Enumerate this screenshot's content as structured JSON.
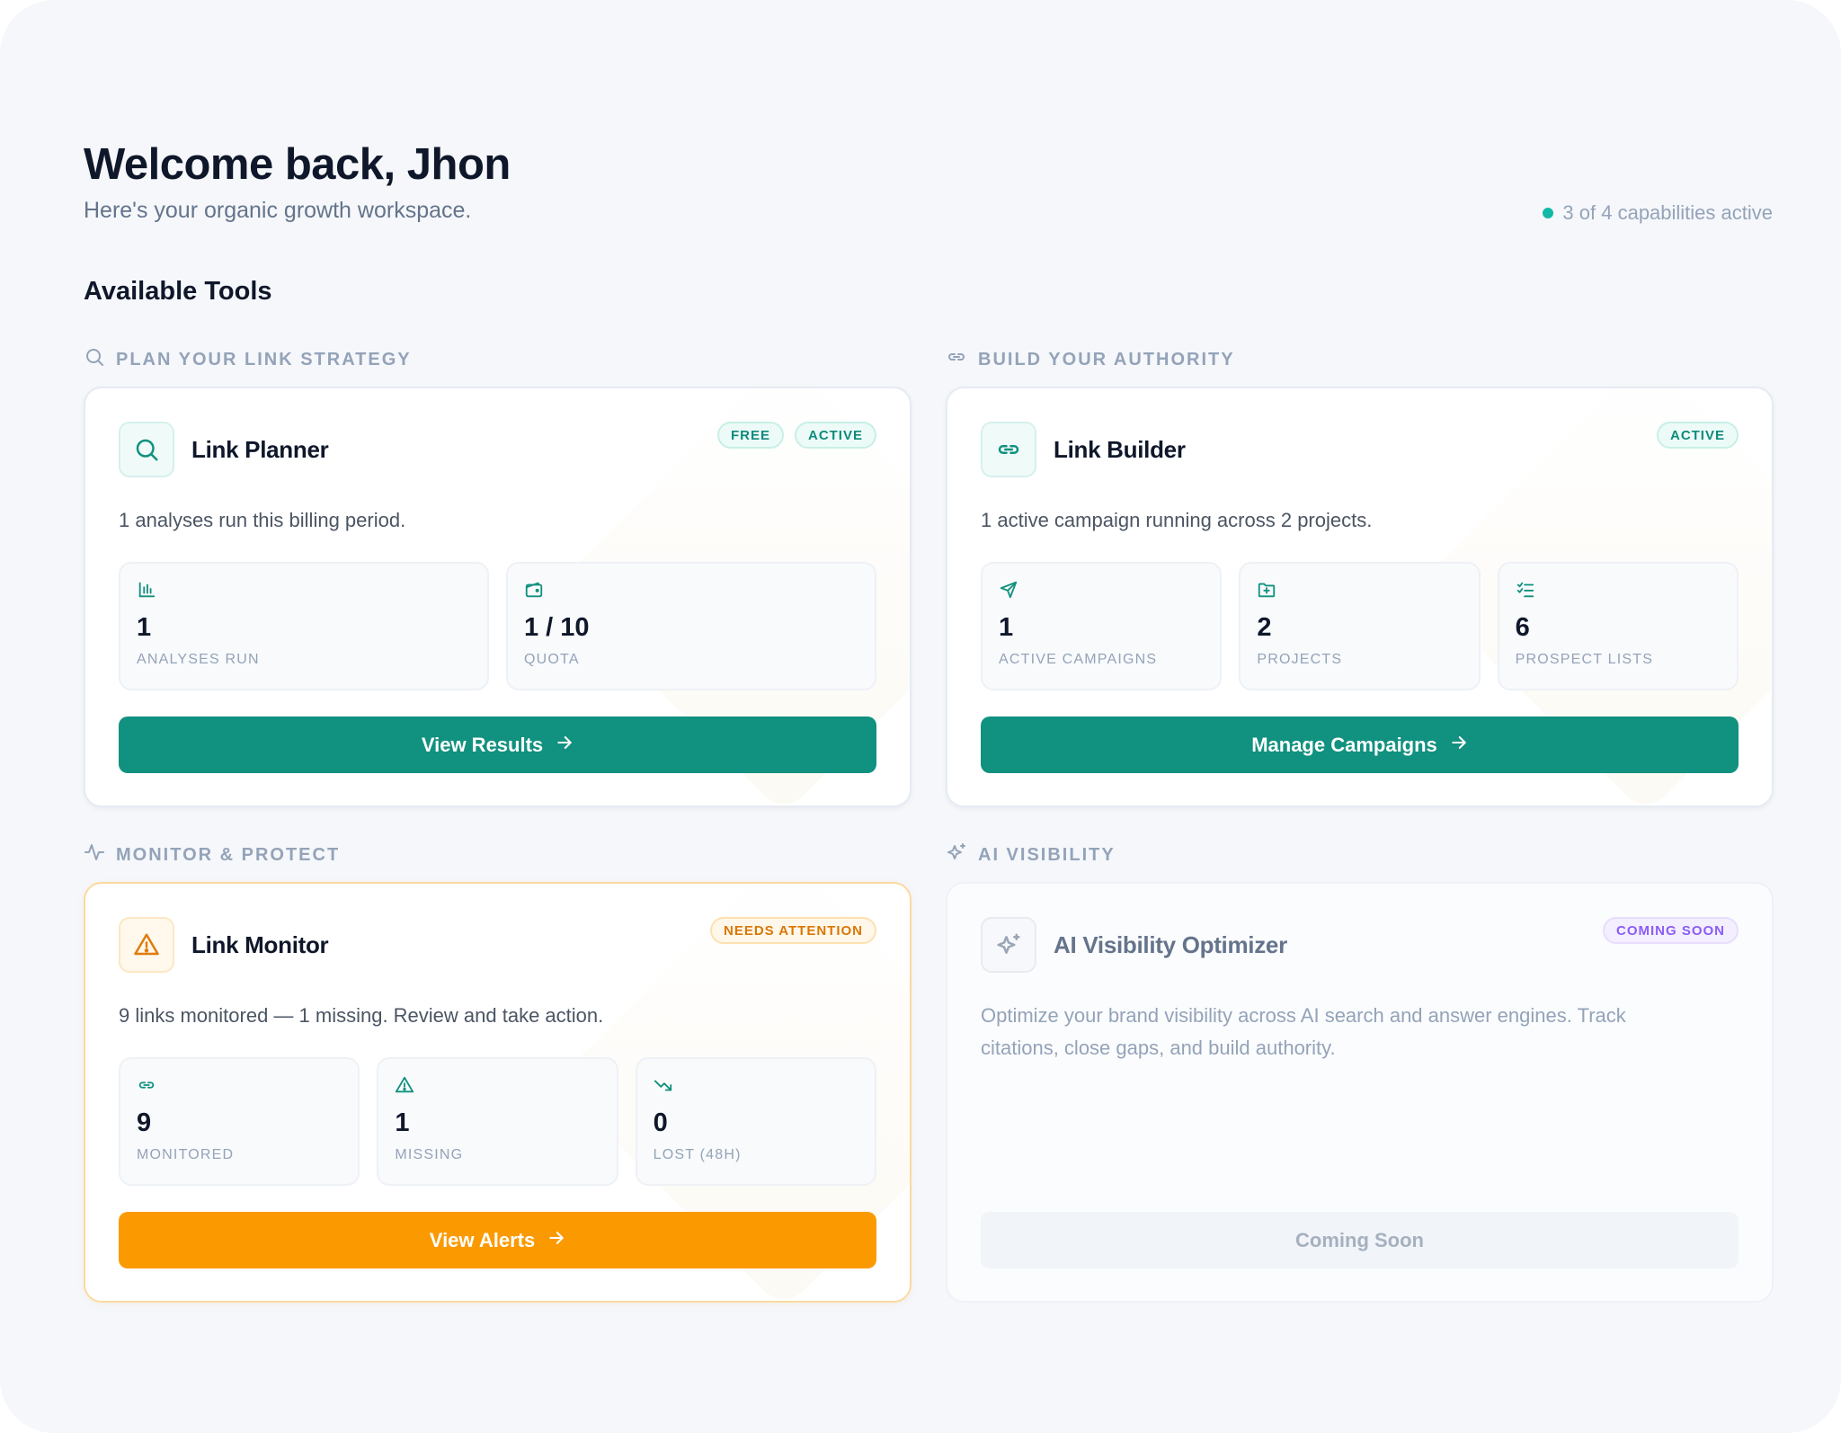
{
  "header": {
    "welcome": "Welcome back, Jhon",
    "subtitle": "Here's your organic growth workspace.",
    "capabilities": "3 of 4 capabilities active"
  },
  "section_title": "Available Tools",
  "colors": {
    "primary": "#11917f",
    "warning": "#fb9a00",
    "purple": "#8b5cf6",
    "status_dot": "#14b8a6"
  },
  "groups": [
    {
      "label": "PLAN YOUR LINK STRATEGY",
      "icon": "search-icon",
      "card": {
        "name": "Link Planner",
        "icon": "search-icon",
        "badges": [
          "FREE",
          "ACTIVE"
        ],
        "description": "1 analyses run this billing period.",
        "stats": [
          {
            "icon": "bar-chart-icon",
            "value": "1",
            "label": "ANALYSES RUN"
          },
          {
            "icon": "wallet-icon",
            "value": "1 / 10",
            "label": "QUOTA"
          }
        ],
        "cta": "View Results"
      }
    },
    {
      "label": "BUILD YOUR AUTHORITY",
      "icon": "link-icon",
      "card": {
        "name": "Link Builder",
        "icon": "link-icon",
        "badges": [
          "ACTIVE"
        ],
        "description": "1 active campaign running across 2 projects.",
        "stats": [
          {
            "icon": "send-icon",
            "value": "1",
            "label": "ACTIVE CAMPAIGNS"
          },
          {
            "icon": "folder-plus-icon",
            "value": "2",
            "label": "PROJECTS"
          },
          {
            "icon": "list-checks-icon",
            "value": "6",
            "label": "PROSPECT LISTS"
          }
        ],
        "cta": "Manage Campaigns"
      }
    },
    {
      "label": "MONITOR & PROTECT",
      "icon": "activity-icon",
      "card": {
        "name": "Link Monitor",
        "icon": "alert-triangle-icon",
        "badges": [
          "NEEDS ATTENTION"
        ],
        "description": "9 links monitored — 1 missing. Review and take action.",
        "stats": [
          {
            "icon": "link-icon",
            "value": "9",
            "label": "MONITORED"
          },
          {
            "icon": "alert-triangle-icon",
            "value": "1",
            "label": "MISSING"
          },
          {
            "icon": "trending-down-icon",
            "value": "0",
            "label": "LOST (48H)"
          }
        ],
        "cta": "View Alerts"
      }
    },
    {
      "label": "AI VISIBILITY",
      "icon": "sparkles-icon",
      "card": {
        "name": "AI Visibility Optimizer",
        "icon": "sparkles-icon",
        "badges": [
          "COMING SOON"
        ],
        "description": "Optimize your brand visibility across AI search and answer engines. Track citations, close gaps, and build authority.",
        "cta": "Coming Soon"
      }
    }
  ]
}
